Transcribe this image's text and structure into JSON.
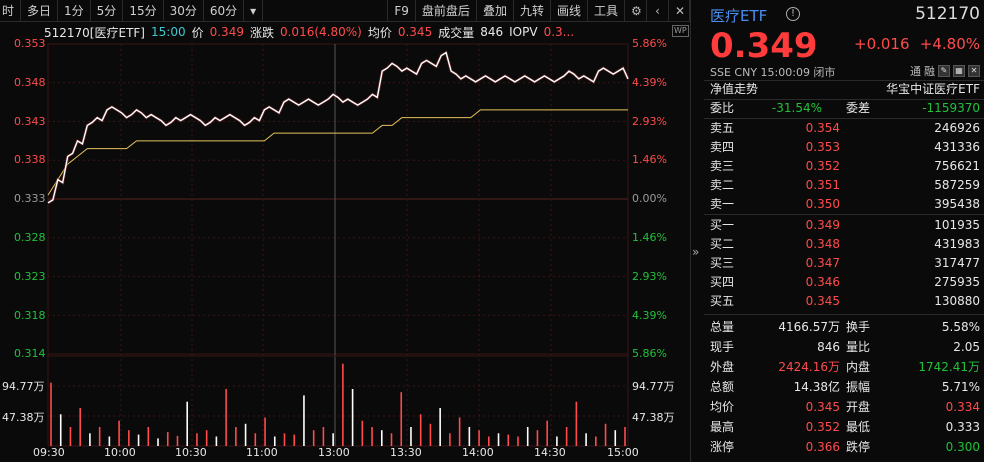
{
  "toolbar": {
    "left": [
      "时",
      "多日",
      "1分",
      "5分",
      "15分",
      "30分",
      "60分"
    ],
    "dropdown": "▾",
    "right": [
      "F9",
      "盘前盘后",
      "叠加",
      "九转",
      "画线",
      "工具"
    ]
  },
  "info": {
    "code_name": "512170[医疗ETF]",
    "time": "15:00",
    "price_label": "价",
    "price": "0.349",
    "change_label": "涨跌",
    "change": "0.016(4.80%)",
    "avg_label": "均价",
    "avg": "0.345",
    "volume_label": "成交量",
    "volume": "846",
    "iopv_label": "IOPV",
    "iopv": "0.3..."
  },
  "wp_label": "WP",
  "price_axis_left": [
    "0.353",
    "0.348",
    "0.343",
    "0.338",
    "0.333",
    "0.328",
    "0.323",
    "0.318",
    "0.314"
  ],
  "price_axis_right": [
    "5.86%",
    "4.39%",
    "2.93%",
    "1.46%",
    "0.00%",
    "1.46%",
    "2.93%",
    "4.39%",
    "5.86%"
  ],
  "volume_axis": [
    "94.77万",
    "47.38万"
  ],
  "time_axis": [
    "09:30",
    "10:00",
    "10:30",
    "11:00",
    "13:00",
    "13:30",
    "14:00",
    "14:30",
    "15:00"
  ],
  "colors": {
    "up": "#ff4b4b",
    "down": "#21c13a",
    "price_line": "#ffffff",
    "avg_line": "#e6c45a",
    "grid": "#3a1414",
    "title_blue": "#4a8ff0"
  },
  "chart_data": {
    "type": "line",
    "title": "",
    "prev_close": 0.333,
    "ylim": [
      0.3135,
      0.3535
    ],
    "time_labels": [
      "09:30",
      "10:00",
      "10:30",
      "11:00",
      "13:00",
      "13:30",
      "14:00",
      "14:30",
      "15:00"
    ],
    "series": [
      {
        "values": [
          0.333,
          0.336,
          0.339,
          0.341,
          0.343,
          0.344,
          0.345,
          0.345,
          0.344,
          0.345,
          0.344,
          0.344,
          0.343,
          0.344,
          0.344,
          0.344,
          0.343,
          0.344,
          0.344,
          0.344,
          0.343,
          0.344,
          0.345,
          0.345,
          0.346,
          0.346,
          0.346,
          0.346,
          0.346,
          0.347,
          0.346,
          0.346,
          0.346,
          0.347,
          0.35,
          0.351,
          0.35,
          0.35,
          0.351,
          0.351,
          0.352,
          0.35,
          0.349,
          0.349,
          0.349,
          0.349,
          0.349,
          0.349,
          0.349,
          0.349,
          0.349,
          0.349,
          0.349,
          0.35,
          0.349,
          0.349,
          0.35,
          0.35,
          0.35,
          0.349
        ]
      },
      {
        "values": [
          0.334,
          0.336,
          0.338,
          0.339,
          0.34,
          0.34,
          0.34,
          0.34,
          0.34,
          0.341,
          0.341,
          0.341,
          0.341,
          0.341,
          0.341,
          0.341,
          0.341,
          0.341,
          0.341,
          0.341,
          0.341,
          0.341,
          0.341,
          0.342,
          0.342,
          0.342,
          0.342,
          0.342,
          0.342,
          0.342,
          0.342,
          0.342,
          0.342,
          0.342,
          0.343,
          0.343,
          0.344,
          0.344,
          0.344,
          0.344,
          0.344,
          0.344,
          0.344,
          0.344,
          0.345,
          0.345,
          0.345,
          0.345,
          0.345,
          0.345,
          0.345,
          0.345,
          0.345,
          0.345,
          0.345,
          0.345,
          0.345,
          0.345,
          0.345,
          0.345
        ]
      }
    ],
    "volume": {
      "ymax": 1421550,
      "values": [
        1000000,
        500000,
        300000,
        600000,
        200000,
        300000,
        150000,
        400000,
        250000,
        180000,
        300000,
        120000,
        220000,
        160000,
        700000,
        200000,
        250000,
        150000,
        900000,
        300000,
        350000,
        200000,
        450000,
        150000,
        200000,
        180000,
        800000,
        250000,
        300000,
        200000,
        1300000,
        900000,
        400000,
        300000,
        250000,
        200000,
        850000,
        300000,
        500000,
        350000,
        600000,
        200000,
        450000,
        300000,
        250000,
        150000,
        200000,
        180000,
        150000,
        300000,
        250000,
        400000,
        150000,
        300000,
        700000,
        200000,
        150000,
        350000,
        250000,
        300000
      ],
      "up": [
        true,
        false,
        true,
        true,
        false,
        true,
        false,
        true,
        true,
        false,
        true,
        false,
        true,
        true,
        false,
        true,
        true,
        false,
        true,
        true,
        false,
        true,
        true,
        false,
        true,
        true,
        false,
        true,
        true,
        false,
        true,
        false,
        true,
        true,
        false,
        true,
        true,
        false,
        true,
        true,
        false,
        true,
        true,
        false,
        true,
        true,
        false,
        true,
        true,
        false,
        true,
        true,
        false,
        true,
        true,
        false,
        true,
        true,
        false,
        true
      ]
    }
  },
  "panel": {
    "name": "医疗ETF",
    "info_icon": "!",
    "code": "512170",
    "price": "0.349",
    "change": "+0.016",
    "change_pct": "+4.80%",
    "meta": "SSE  CNY  15:00:09  闭市",
    "meta_icons": [
      "通",
      "融"
    ],
    "nav_label": "净值走势",
    "nav_index": "华宝中证医疗ETF",
    "weibi_label": "委比",
    "weibi": "-31.54%",
    "weicha_label": "委差",
    "weicha": "-1159370",
    "asks": [
      {
        "label": "卖五",
        "price": "0.354",
        "vol": "246926"
      },
      {
        "label": "卖四",
        "price": "0.353",
        "vol": "431336"
      },
      {
        "label": "卖三",
        "price": "0.352",
        "vol": "756621"
      },
      {
        "label": "卖二",
        "price": "0.351",
        "vol": "587259"
      },
      {
        "label": "卖一",
        "price": "0.350",
        "vol": "395438"
      }
    ],
    "bids": [
      {
        "label": "买一",
        "price": "0.349",
        "vol": "101935"
      },
      {
        "label": "买二",
        "price": "0.348",
        "vol": "431983"
      },
      {
        "label": "买三",
        "price": "0.347",
        "vol": "317477"
      },
      {
        "label": "买四",
        "price": "0.346",
        "vol": "275935"
      },
      {
        "label": "买五",
        "price": "0.345",
        "vol": "130880"
      }
    ],
    "stats": [
      {
        "l1": "总量",
        "v1": "4166.57万",
        "c1": "white",
        "l2": "换手",
        "v2": "5.58%",
        "c2": "white"
      },
      {
        "l1": "现手",
        "v1": "846",
        "c1": "white",
        "l2": "量比",
        "v2": "2.05",
        "c2": "white"
      },
      {
        "l1": "外盘",
        "v1": "2424.16万",
        "c1": "red",
        "l2": "内盘",
        "v2": "1742.41万",
        "c2": "green"
      },
      {
        "l1": "总额",
        "v1": "14.38亿",
        "c1": "white",
        "l2": "振幅",
        "v2": "5.71%",
        "c2": "white"
      },
      {
        "l1": "均价",
        "v1": "0.345",
        "c1": "red",
        "l2": "开盘",
        "v2": "0.334",
        "c2": "red"
      },
      {
        "l1": "最高",
        "v1": "0.352",
        "c1": "red",
        "l2": "最低",
        "v2": "0.333",
        "c2": "white"
      },
      {
        "l1": "涨停",
        "v1": "0.366",
        "c1": "red",
        "l2": "跌停",
        "v2": "0.300",
        "c2": "green"
      }
    ]
  }
}
